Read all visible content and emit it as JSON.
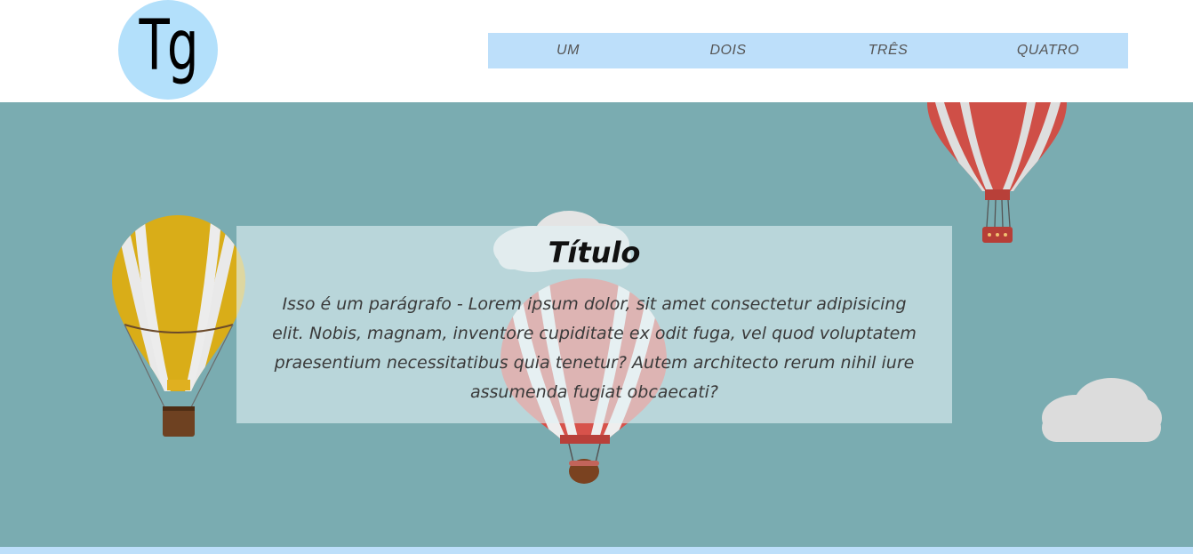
{
  "logo": {
    "text": "Tg"
  },
  "nav": {
    "items": [
      {
        "label": "UM"
      },
      {
        "label": "DOIS"
      },
      {
        "label": "TRÊS"
      },
      {
        "label": "QUATRO"
      }
    ]
  },
  "hero": {
    "title": "Título",
    "paragraph": "Isso é um parágrafo - Lorem ipsum dolor, sit amet consectetur adipisicing elit. Nobis, magnam, inventore cupiditate ex odit fuga, vel quod voluptatem praesentium necessitatibus quia tenetur? Autem architecto rerum nihil iure assumenda fugiat obcaecati?"
  },
  "colors": {
    "logo_bg": "#b3e0fb",
    "nav_bg": "#bddffa",
    "hero_bg": "#7aacb1"
  }
}
